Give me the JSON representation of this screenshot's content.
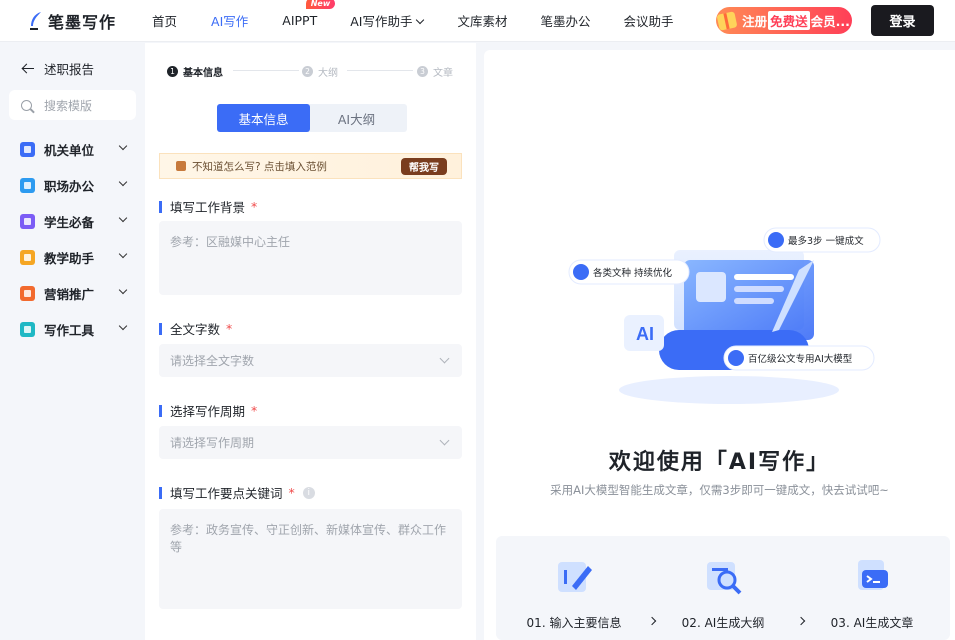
{
  "header": {
    "logo_text": "笔墨写作",
    "nav": [
      {
        "label": "首页",
        "active": false
      },
      {
        "label": "AI写作",
        "active": true
      },
      {
        "label": "AIPPT",
        "active": false,
        "badge": "New"
      },
      {
        "label": "AI写作助手",
        "active": false,
        "dropdown": true
      },
      {
        "label": "文库素材",
        "active": false
      },
      {
        "label": "笔墨办公",
        "active": false
      },
      {
        "label": "会议助手",
        "active": false
      }
    ],
    "promo": {
      "prefix": "注册",
      "highlight": "免费送",
      "suffix": "会员..."
    },
    "login_label": "登录"
  },
  "sidebar": {
    "back_label": "述职报告",
    "search_placeholder": "搜索模版",
    "items": [
      {
        "label": "机关单位",
        "color": "#3b6cf6"
      },
      {
        "label": "职场办公",
        "color": "#2d9bf0"
      },
      {
        "label": "学生必备",
        "color": "#7b5cf5"
      },
      {
        "label": "教学助手",
        "color": "#f5a623"
      },
      {
        "label": "营销推广",
        "color": "#f26a2e"
      },
      {
        "label": "写作工具",
        "color": "#1fb8c4"
      }
    ]
  },
  "form": {
    "steps": [
      {
        "num": "1",
        "label": "基本信息",
        "active": true
      },
      {
        "num": "2",
        "label": "大纲",
        "active": false
      },
      {
        "num": "3",
        "label": "文章",
        "active": false
      }
    ],
    "tabs": [
      {
        "label": "基本信息",
        "active": true
      },
      {
        "label": "AI大纲",
        "active": false
      }
    ],
    "hint": {
      "text": "不知道怎么写? 点击填入范例",
      "button": "帮我写"
    },
    "fields": {
      "background": {
        "label": "填写工作背景",
        "required": "*",
        "placeholder": "参考：区融媒中心主任"
      },
      "word_count": {
        "label": "全文字数",
        "required": "*",
        "placeholder": "请选择全文字数"
      },
      "period": {
        "label": "选择写作周期",
        "required": "*",
        "placeholder": "请选择写作周期"
      },
      "keywords": {
        "label": "填写工作要点关键词",
        "required": "*",
        "placeholder": "参考：政务宣传、守正创新、新媒体宣传、群众工作等"
      }
    }
  },
  "main": {
    "illustration": {
      "tag1": "最多3步 一键成文",
      "tag2": "各类文种 持续优化",
      "tag3": "百亿级公文专用AI大模型",
      "ai_badge": "AI"
    },
    "welcome_title": "欢迎使用「AI写作」",
    "welcome_sub": "采用AI大模型智能生成文章，仅需3步即可一键成文，快去试试吧~",
    "steps": [
      {
        "label": "01. 输入主要信息",
        "icon": "edit-doc-icon"
      },
      {
        "label": "02. AI生成大纲",
        "icon": "magnify-doc-icon"
      },
      {
        "label": "03. AI生成文章",
        "icon": "terminal-doc-icon"
      }
    ]
  },
  "colors": {
    "accent": "#3b6cf6",
    "promo": "#ff3f57",
    "required": "#f04a4a"
  }
}
